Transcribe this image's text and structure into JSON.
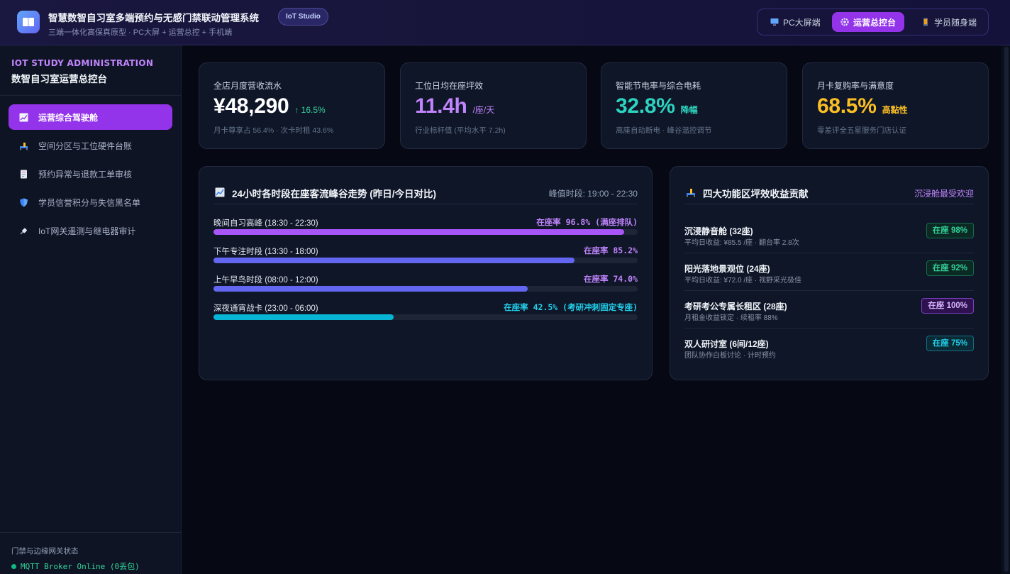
{
  "header": {
    "title": "智慧数智自习室多端预约与无感门禁联动管理系统",
    "subtitle": "三端一体化高保真原型 · PC大屏 + 运营总控 + 手机端",
    "badge": "IoT Studio",
    "modes": [
      {
        "label": "PC大屏端",
        "icon": "monitor-icon"
      },
      {
        "label": "运营总控台",
        "icon": "gear-icon",
        "active": true
      },
      {
        "label": "学员随身端",
        "icon": "phone-icon"
      }
    ]
  },
  "sidebar": {
    "eyebrow": "IOT STUDY ADMINISTRATION",
    "title": "数智自习室运营总控台",
    "items": [
      {
        "label": "运营综合驾驶舱",
        "icon": "chart-icon",
        "active": true
      },
      {
        "label": "空间分区与工位硬件台账",
        "icon": "seat-icon"
      },
      {
        "label": "预约异常与退款工单审核",
        "icon": "document-icon"
      },
      {
        "label": "学员信誉积分与失信黑名单",
        "icon": "shield-icon"
      },
      {
        "label": "IoT网关遥测与继电器审计",
        "icon": "plug-icon"
      }
    ],
    "gateway_label": "门禁与边缘网关状态",
    "gateway_status": "MQTT Broker Online (0丢包)"
  },
  "kpis": [
    {
      "label": "全店月度营收流水",
      "value": "¥48,290",
      "suffix": "↑ 16.5%",
      "note": "月卡尊享占 56.4% · 次卡时租 43.6%",
      "value_color": "#ffffff",
      "suffix_color": "#34d399"
    },
    {
      "label": "工位日均在座坪效",
      "value": "11.4h",
      "suffix": "/座/天",
      "note": "行业标杆值 (平均水平 7.2h)",
      "value_color": "#c084fc",
      "suffix_color": "#c084fc"
    },
    {
      "label": "智能节电率与综合电耗",
      "value": "32.8%",
      "suffix": "降幅",
      "note": "离座自动断电 · 峰谷温控调节",
      "value_color": "#2dd4bf",
      "suffix_color": "#2dd4bf"
    },
    {
      "label": "月卡复购率与满意度",
      "value": "68.5%",
      "suffix": "高黏性",
      "note": "零差评全五星服务门店认证",
      "value_color": "#fbbf24",
      "suffix_color": "#fbbf24"
    }
  ],
  "occupancy": {
    "title": "24小时各时段在座客流峰谷走势 (昨日/今日对比)",
    "peak": "峰值时段: 19:00 - 22:30",
    "rows": [
      {
        "label": "晚间自习高峰 (18:30 - 22:30)",
        "value_text": "在座率 96.8% (满座排队)",
        "pct": 96.8,
        "color": "#a855f7",
        "text_color": "#c084fc"
      },
      {
        "label": "下午专注时段 (13:30 - 18:00)",
        "value_text": "在座率 85.2%",
        "pct": 85.2,
        "color": "#6366f1",
        "text_color": "#c084fc"
      },
      {
        "label": "上午早鸟时段 (08:00 - 12:00)",
        "value_text": "在座率 74.0%",
        "pct": 74.0,
        "color": "#6366f1",
        "text_color": "#c084fc"
      },
      {
        "label": "深夜通宵战卡 (23:00 - 06:00)",
        "value_text": "在座率 42.5% (考研冲刺固定专座)",
        "pct": 42.5,
        "color": "#06b6d4",
        "text_color": "#22d3ee"
      }
    ]
  },
  "zones": {
    "title": "四大功能区坪效收益贡献",
    "side": "沉浸舱最受欢迎",
    "rows": [
      {
        "name": "沉浸静音舱 (32座)",
        "meta": "平均日收益: ¥85.5 /座 · 翻台率 2.8次",
        "badge": "在座 98%",
        "fg": "#34d399",
        "bg": "#0b2a24",
        "border": "#166b4f"
      },
      {
        "name": "阳光落地景观位 (24座)",
        "meta": "平均日收益: ¥72.0 /座 · 视野采光极佳",
        "badge": "在座 92%",
        "fg": "#34d399",
        "bg": "#0b2a24",
        "border": "#166b4f"
      },
      {
        "name": "考研考公专属长租区 (28座)",
        "meta": "月租金收益锁定 · 续租率 88%",
        "badge": "在座 100%",
        "fg": "#d8b4fe",
        "bg": "#2e1250",
        "border": "#7e3fc2"
      },
      {
        "name": "双人研讨室 (6间/12座)",
        "meta": "团队协作白板讨论 · 计时预约",
        "badge": "在座 75%",
        "fg": "#22d3ee",
        "bg": "#0a2a36",
        "border": "#166e86"
      }
    ]
  }
}
